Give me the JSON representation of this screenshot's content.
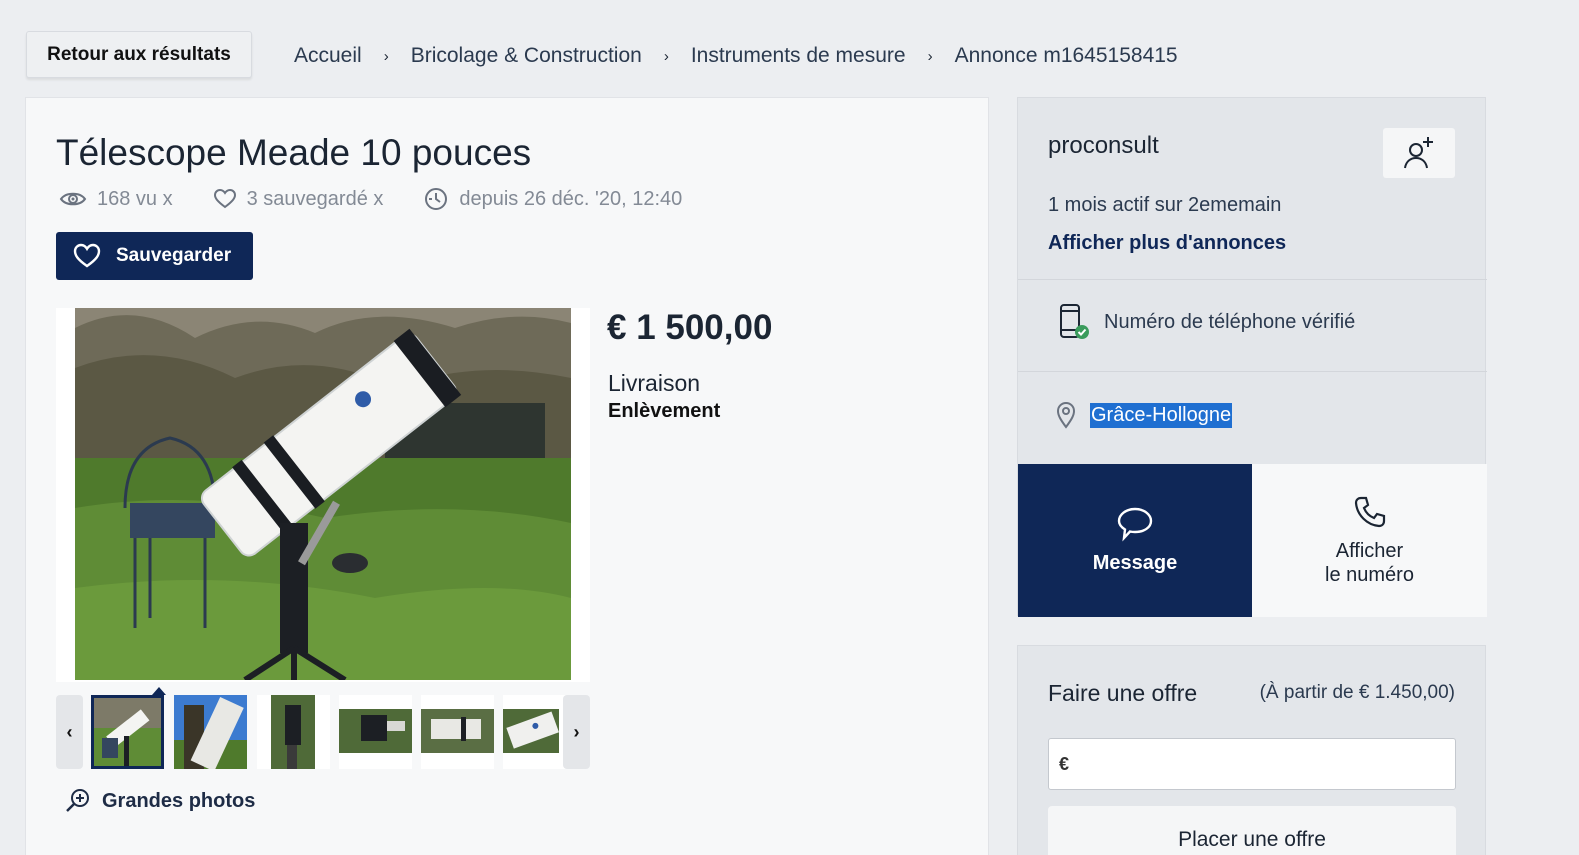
{
  "nav": {
    "back_label": "Retour aux résultats",
    "breadcrumbs": [
      "Accueil",
      "Bricolage & Construction",
      "Instruments de mesure",
      "Annonce m1645158415"
    ],
    "separator": "›"
  },
  "listing": {
    "title": "Télescope Meade 10 pouces",
    "views": "168 vu x",
    "saves": "3 sauvegardé x",
    "since": "depuis 26 déc. '20, 12:40",
    "save_label": "Sauvegarder",
    "price": "€ 1 500,00",
    "delivery_label": "Livraison",
    "delivery_value": "Enlèvement",
    "big_photos_label": "Grandes photos",
    "thumb_prev": "‹",
    "thumb_next": "›"
  },
  "seller": {
    "name": "proconsult",
    "active": "1 mois actif sur 2ememain",
    "more_ads": "Afficher plus d'annonces",
    "phone_verified": "Numéro de téléphone vérifié",
    "location": "Grâce-Hollogne",
    "message_label": "Message",
    "call_label_line1": "Afficher",
    "call_label_line2": "le numéro"
  },
  "offer": {
    "title": "Faire une offre",
    "min": "(À partir de € 1.450,00)",
    "currency": "€",
    "input_value": "",
    "button_label": "Placer une offre"
  },
  "colors": {
    "primary": "#0f2757",
    "background": "#eceef1",
    "highlight": "#1f6fd1",
    "verified": "#3a9b5c"
  }
}
